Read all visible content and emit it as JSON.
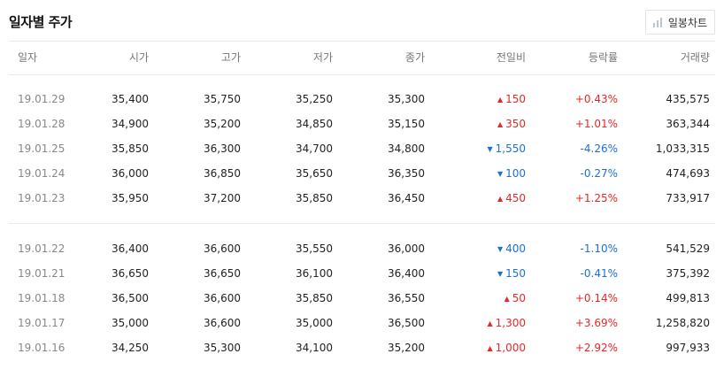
{
  "title": "일자별 주가",
  "chart_button": {
    "label": "일봉차트",
    "icon": "bar-chart-icon"
  },
  "columns": [
    "일자",
    "시가",
    "고가",
    "저가",
    "종가",
    "전일비",
    "등락률",
    "거래량"
  ],
  "colors": {
    "up": "#e52828",
    "down": "#1c6fd6"
  },
  "groups": [
    [
      {
        "date": "19.01.29",
        "open": "35,400",
        "high": "35,750",
        "low": "35,250",
        "close": "35,300",
        "dir": "up",
        "change": "150",
        "rate": "+0.43%",
        "volume": "435,575"
      },
      {
        "date": "19.01.28",
        "open": "34,900",
        "high": "35,200",
        "low": "34,850",
        "close": "35,150",
        "dir": "up",
        "change": "350",
        "rate": "+1.01%",
        "volume": "363,344"
      },
      {
        "date": "19.01.25",
        "open": "35,850",
        "high": "36,300",
        "low": "34,700",
        "close": "34,800",
        "dir": "down",
        "change": "1,550",
        "rate": "-4.26%",
        "volume": "1,033,315"
      },
      {
        "date": "19.01.24",
        "open": "36,000",
        "high": "36,850",
        "low": "35,650",
        "close": "36,350",
        "dir": "down",
        "change": "100",
        "rate": "-0.27%",
        "volume": "474,693"
      },
      {
        "date": "19.01.23",
        "open": "35,950",
        "high": "37,200",
        "low": "35,850",
        "close": "36,450",
        "dir": "up",
        "change": "450",
        "rate": "+1.25%",
        "volume": "733,917"
      }
    ],
    [
      {
        "date": "19.01.22",
        "open": "36,400",
        "high": "36,600",
        "low": "35,550",
        "close": "36,000",
        "dir": "down",
        "change": "400",
        "rate": "-1.10%",
        "volume": "541,529"
      },
      {
        "date": "19.01.21",
        "open": "36,650",
        "high": "36,650",
        "low": "36,100",
        "close": "36,400",
        "dir": "down",
        "change": "150",
        "rate": "-0.41%",
        "volume": "375,392"
      },
      {
        "date": "19.01.18",
        "open": "36,500",
        "high": "36,600",
        "low": "35,850",
        "close": "36,550",
        "dir": "up",
        "change": "50",
        "rate": "+0.14%",
        "volume": "499,813"
      },
      {
        "date": "19.01.17",
        "open": "35,000",
        "high": "36,600",
        "low": "35,000",
        "close": "36,500",
        "dir": "up",
        "change": "1,300",
        "rate": "+3.69%",
        "volume": "1,258,820"
      },
      {
        "date": "19.01.16",
        "open": "34,250",
        "high": "35,300",
        "low": "34,100",
        "close": "35,200",
        "dir": "up",
        "change": "1,000",
        "rate": "+2.92%",
        "volume": "997,933"
      }
    ]
  ]
}
